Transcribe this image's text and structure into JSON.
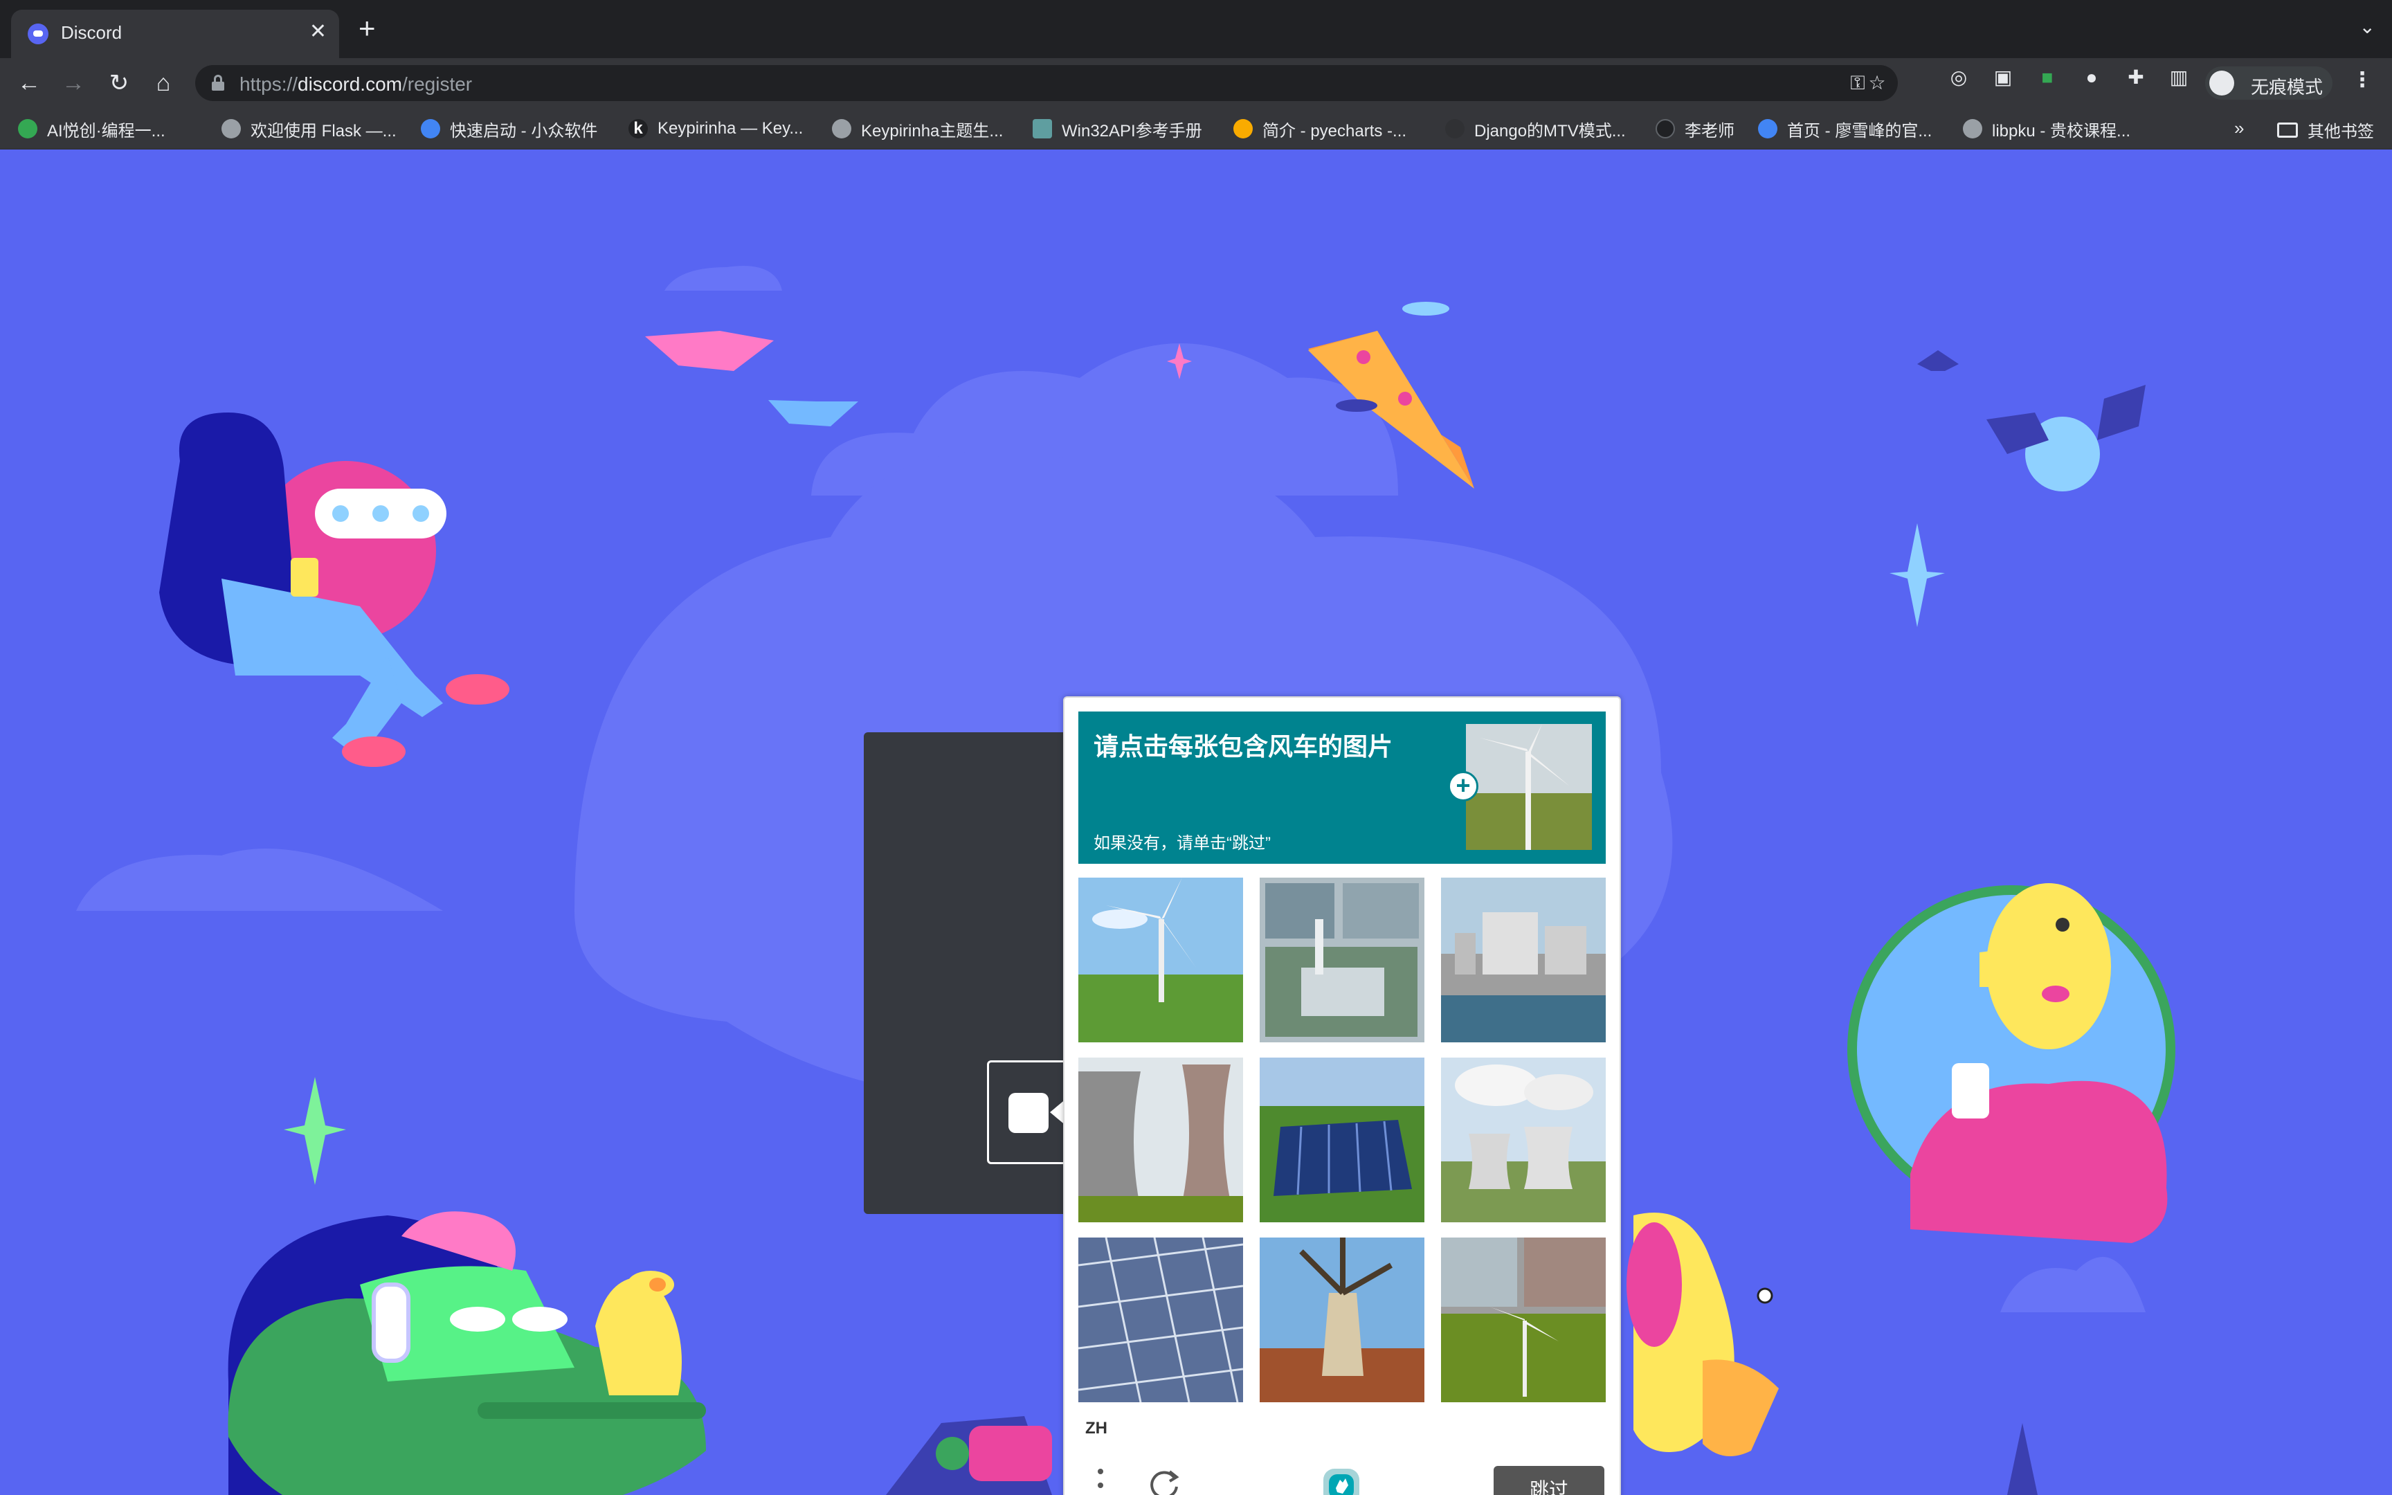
{
  "browser": {
    "tab": {
      "title": "Discord",
      "close": "✕"
    },
    "new_tab": "+",
    "omnibox": {
      "url_scheme": "https://",
      "url_host": "discord.com",
      "url_path": "/register"
    },
    "incognito_label": "无痕模式",
    "bookmarks": [
      {
        "label": "AI悦创·编程一...",
        "icon_color": "#34a853"
      },
      {
        "label": "欢迎使用 Flask —...",
        "icon_color": "#9aa0a6"
      },
      {
        "label": "快速启动 - 小众软件",
        "icon_color": "#4285f4"
      },
      {
        "label": "Keypirinha — Key...",
        "icon_color": "#202124"
      },
      {
        "label": "Keypirinha主题生...",
        "icon_color": "#9aa0a6"
      },
      {
        "label": "Win32API参考手册",
        "icon_color": "#5f9ea0"
      },
      {
        "label": "简介 - pyecharts -...",
        "icon_color": "#f9ab00"
      },
      {
        "label": "Django的MTV模式...",
        "icon_color": "#303134"
      },
      {
        "label": "李老师",
        "icon_color": "#202124"
      },
      {
        "label": "首页 - 廖雪峰的官...",
        "icon_color": "#4285f4"
      },
      {
        "label": "libpku - 贵校课程...",
        "icon_color": "#9aa0a6"
      }
    ],
    "bookmarks_more": "»",
    "other_bookmarks": "其他书签"
  },
  "captcha": {
    "prompt": "请点击每张包含风车的图片",
    "sub_prompt": "如果没有，请单击“跳过”",
    "language": "ZH",
    "skip_label": "跳过",
    "accent_color": "#00838f",
    "tiles": [
      {
        "subject": "wind-turbine"
      },
      {
        "subject": "industrial-collage"
      },
      {
        "subject": "power-plant"
      },
      {
        "subject": "cooling-towers"
      },
      {
        "subject": "solar-panels"
      },
      {
        "subject": "cooling-towers-smoke"
      },
      {
        "subject": "solar-panel-closeup"
      },
      {
        "subject": "windmill"
      },
      {
        "subject": "wind-turbine-collage"
      }
    ]
  },
  "colors": {
    "page_background": "#5865f2",
    "chrome_dark": "#202124",
    "chrome_mid": "#35363a"
  }
}
